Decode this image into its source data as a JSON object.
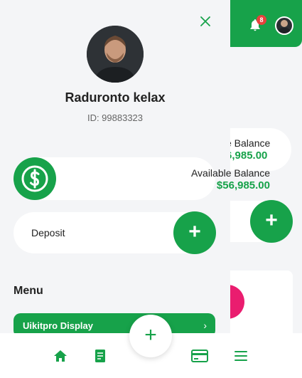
{
  "colors": {
    "accent": "#17a24a",
    "badge": "#e8413c",
    "background": "#f4f5f7",
    "pink_accent": "#ea1d6f"
  },
  "header": {
    "notification_count": "8",
    "bell_icon": "bell-icon"
  },
  "background_screen": {
    "balance_label_partial": "e Balance",
    "balance_value_partial": "6,985.00"
  },
  "drawer": {
    "user": {
      "name": "Raduronto kelax",
      "id_text": "ID: 99883323"
    },
    "balance": {
      "label": "Available Balance",
      "value": "$56,985.00"
    },
    "deposit": {
      "label": "Deposit",
      "plus": "+"
    },
    "menu": {
      "title": "Menu",
      "items": [
        {
          "label": "Uikitpro Display",
          "chevron": "›"
        }
      ]
    }
  },
  "bottom_nav": {
    "fab_label": "+",
    "items": [
      "home-icon",
      "document-icon",
      "card-icon",
      "menu-icon"
    ]
  },
  "background_plus": "+"
}
